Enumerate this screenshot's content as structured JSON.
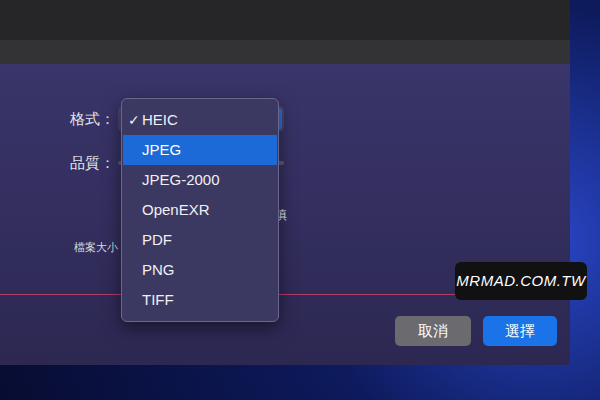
{
  "labels": {
    "format": "格式：",
    "quality": "品質：",
    "file_size": "檔案大小："
  },
  "partial_option_text": "填",
  "format_menu": {
    "check_mark": "✓",
    "items": [
      {
        "label": "HEIC",
        "checked": true,
        "selected": false
      },
      {
        "label": "JPEG",
        "checked": false,
        "selected": true
      },
      {
        "label": "JPEG-2000",
        "checked": false,
        "selected": false
      },
      {
        "label": "OpenEXR",
        "checked": false,
        "selected": false
      },
      {
        "label": "PDF",
        "checked": false,
        "selected": false
      },
      {
        "label": "PNG",
        "checked": false,
        "selected": false
      },
      {
        "label": "TIFF",
        "checked": false,
        "selected": false
      }
    ]
  },
  "buttons": [
    {
      "label": "取消",
      "primary": false
    },
    {
      "label": "選擇",
      "primary": true
    }
  ],
  "watermark": "MRMAD.COM.TW"
}
